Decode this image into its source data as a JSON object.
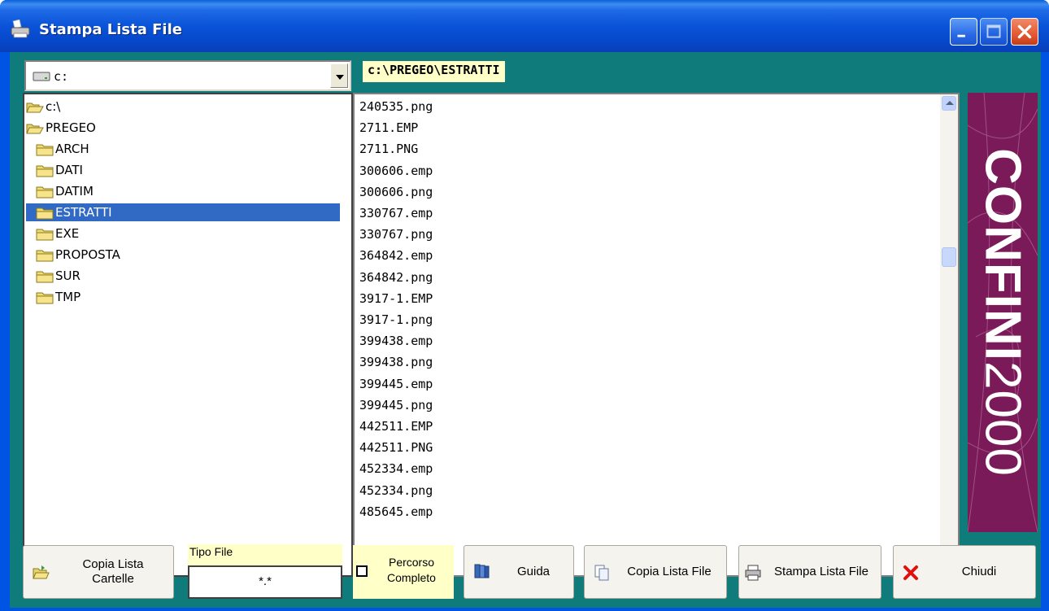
{
  "window": {
    "title": "Stampa Lista File",
    "controls": [
      "minimize",
      "maximize",
      "close"
    ]
  },
  "drive": {
    "value": "c:",
    "icon": "drive-icon"
  },
  "current_path": "c:\\PREGEO\\ESTRATTI",
  "tree": {
    "items": [
      {
        "label": "c:\\",
        "icon": "folder-open-icon",
        "level": 0,
        "selected": false
      },
      {
        "label": "PREGEO",
        "icon": "folder-open-icon",
        "level": 0,
        "selected": false
      },
      {
        "label": "ARCH",
        "icon": "folder-icon",
        "level": 1,
        "selected": false
      },
      {
        "label": "DATI",
        "icon": "folder-icon",
        "level": 1,
        "selected": false
      },
      {
        "label": "DATIM",
        "icon": "folder-icon",
        "level": 1,
        "selected": false
      },
      {
        "label": "ESTRATTI",
        "icon": "folder-icon",
        "level": 1,
        "selected": true
      },
      {
        "label": "EXE",
        "icon": "folder-icon",
        "level": 1,
        "selected": false
      },
      {
        "label": "PROPOSTA",
        "icon": "folder-icon",
        "level": 1,
        "selected": false
      },
      {
        "label": "SUR",
        "icon": "folder-icon",
        "level": 1,
        "selected": false
      },
      {
        "label": "TMP",
        "icon": "folder-icon",
        "level": 1,
        "selected": false
      }
    ]
  },
  "files": [
    "240535.png",
    "2711.EMP",
    "2711.PNG",
    "300606.emp",
    "300606.png",
    "330767.emp",
    "330767.png",
    "364842.emp",
    "364842.png",
    "3917-1.EMP",
    "3917-1.png",
    "399438.emp",
    "399438.png",
    "399445.emp",
    "399445.png",
    "442511.EMP",
    "442511.PNG",
    "452334.emp",
    "452334.png",
    "485645.emp"
  ],
  "brand": {
    "part1": "CONFINI",
    "part2": "2000",
    "color": "#7a1a58"
  },
  "buttons": {
    "copia_cartelle_line1": "Copia Lista",
    "copia_cartelle_line2": "Cartelle",
    "tipo_file_label": "Tipo File",
    "tipo_file_value": "*.*",
    "percorso_line1": "Percorso",
    "percorso_line2": "Completo",
    "guida": "Guida",
    "copia_file": "Copia Lista File",
    "stampa_file": "Stampa Lista File",
    "chiudi": "Chiudi"
  },
  "colors": {
    "client_bg": "#0f7b7b",
    "selection": "#316ac5",
    "highlight_yellow": "#ffffc8"
  }
}
